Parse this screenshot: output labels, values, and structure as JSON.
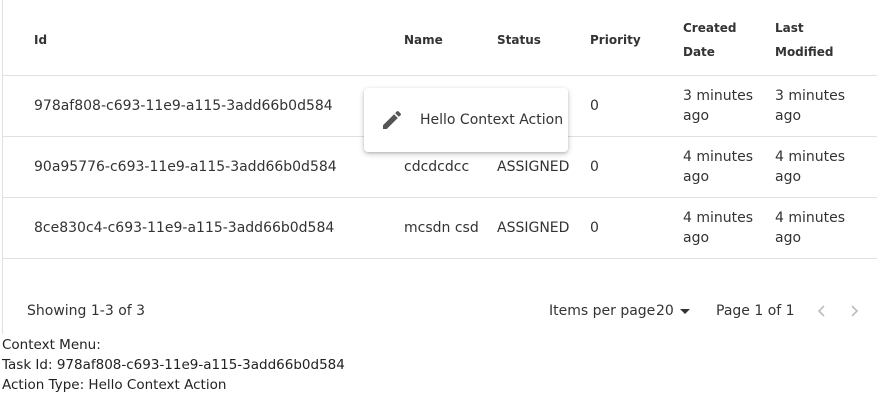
{
  "table": {
    "headers": {
      "id": "Id",
      "name": "Name",
      "status": "Status",
      "priority": "Priority",
      "created_line1": "Created",
      "created_line2": "Date",
      "modified_line1": "Last",
      "modified_line2": "Modified"
    },
    "rows": [
      {
        "id": "978af808-c693-11e9-a115-3add66b0d584",
        "name": "",
        "status": "",
        "priority": "0",
        "created_line1": "3 minutes",
        "created_line2": "ago",
        "modified_line1": "3 minutes",
        "modified_line2": "ago"
      },
      {
        "id": "90a95776-c693-11e9-a115-3add66b0d584",
        "name": "cdcdcdcc",
        "status": "ASSIGNED",
        "priority": "0",
        "created_line1": "4 minutes",
        "created_line2": "ago",
        "modified_line1": "4 minutes",
        "modified_line2": "ago"
      },
      {
        "id": "8ce830c4-c693-11e9-a115-3add66b0d584",
        "name": "mcsdn csd",
        "status": "ASSIGNED",
        "priority": "0",
        "created_line1": "4 minutes",
        "created_line2": "ago",
        "modified_line1": "4 minutes",
        "modified_line2": "ago"
      }
    ]
  },
  "pagination": {
    "showing": "Showing 1-3 of 3",
    "items_per_page_label": "Items per page",
    "items_per_page_value": "20",
    "page_label": "Page 1 of 1",
    "prev_icon": "chevron-left-icon",
    "next_icon": "chevron-right-icon"
  },
  "context_menu": {
    "item_label": "Hello Context Action",
    "item_icon": "pencil-icon"
  },
  "info": {
    "line1": "Context Menu:",
    "line2": "Task Id: 978af808-c693-11e9-a115-3add66b0d584",
    "line3": "Action Type: Hello Context Action"
  }
}
